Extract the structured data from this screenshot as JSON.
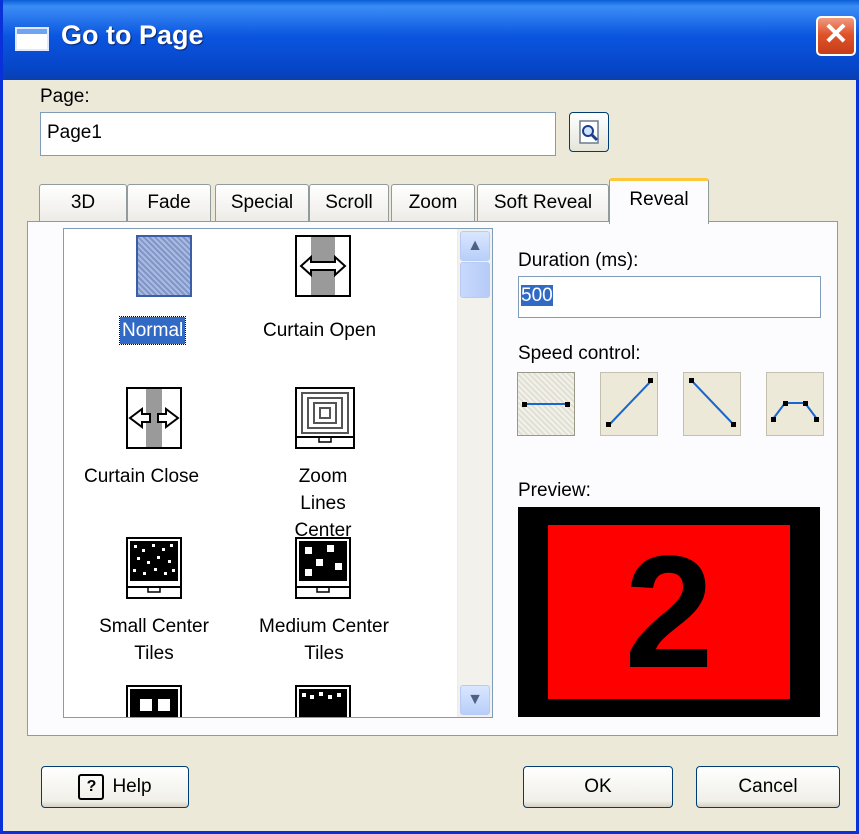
{
  "window": {
    "title": "Go to Page",
    "close_glyph": "✕"
  },
  "page_field": {
    "label": "Page:",
    "value": "Page1",
    "browse_icon": "magnifier-icon"
  },
  "tabs": [
    {
      "label": "3D"
    },
    {
      "label": "Fade"
    },
    {
      "label": "Special"
    },
    {
      "label": "Scroll"
    },
    {
      "label": "Zoom"
    },
    {
      "label": "Soft Reveal"
    },
    {
      "label": "Reveal",
      "active": true
    }
  ],
  "effects": [
    {
      "name": "Normal",
      "selected": true
    },
    {
      "name": "Curtain Open"
    },
    {
      "name": "Curtain Close"
    },
    {
      "name": "Zoom Lines Center"
    },
    {
      "name": "Small Center Tiles"
    },
    {
      "name": "Medium Center Tiles"
    }
  ],
  "duration": {
    "label": "Duration (ms):",
    "value": "500"
  },
  "speed_control": {
    "label": "Speed control:",
    "options": [
      "constant",
      "accelerate",
      "decelerate",
      "ease-in-out"
    ],
    "selected": "constant"
  },
  "preview": {
    "label": "Preview:",
    "text": "2",
    "background": "#ff0000"
  },
  "buttons": {
    "help": "Help",
    "ok": "OK",
    "cancel": "Cancel"
  },
  "scrollbar": {
    "up": "▲",
    "down": "▼"
  }
}
